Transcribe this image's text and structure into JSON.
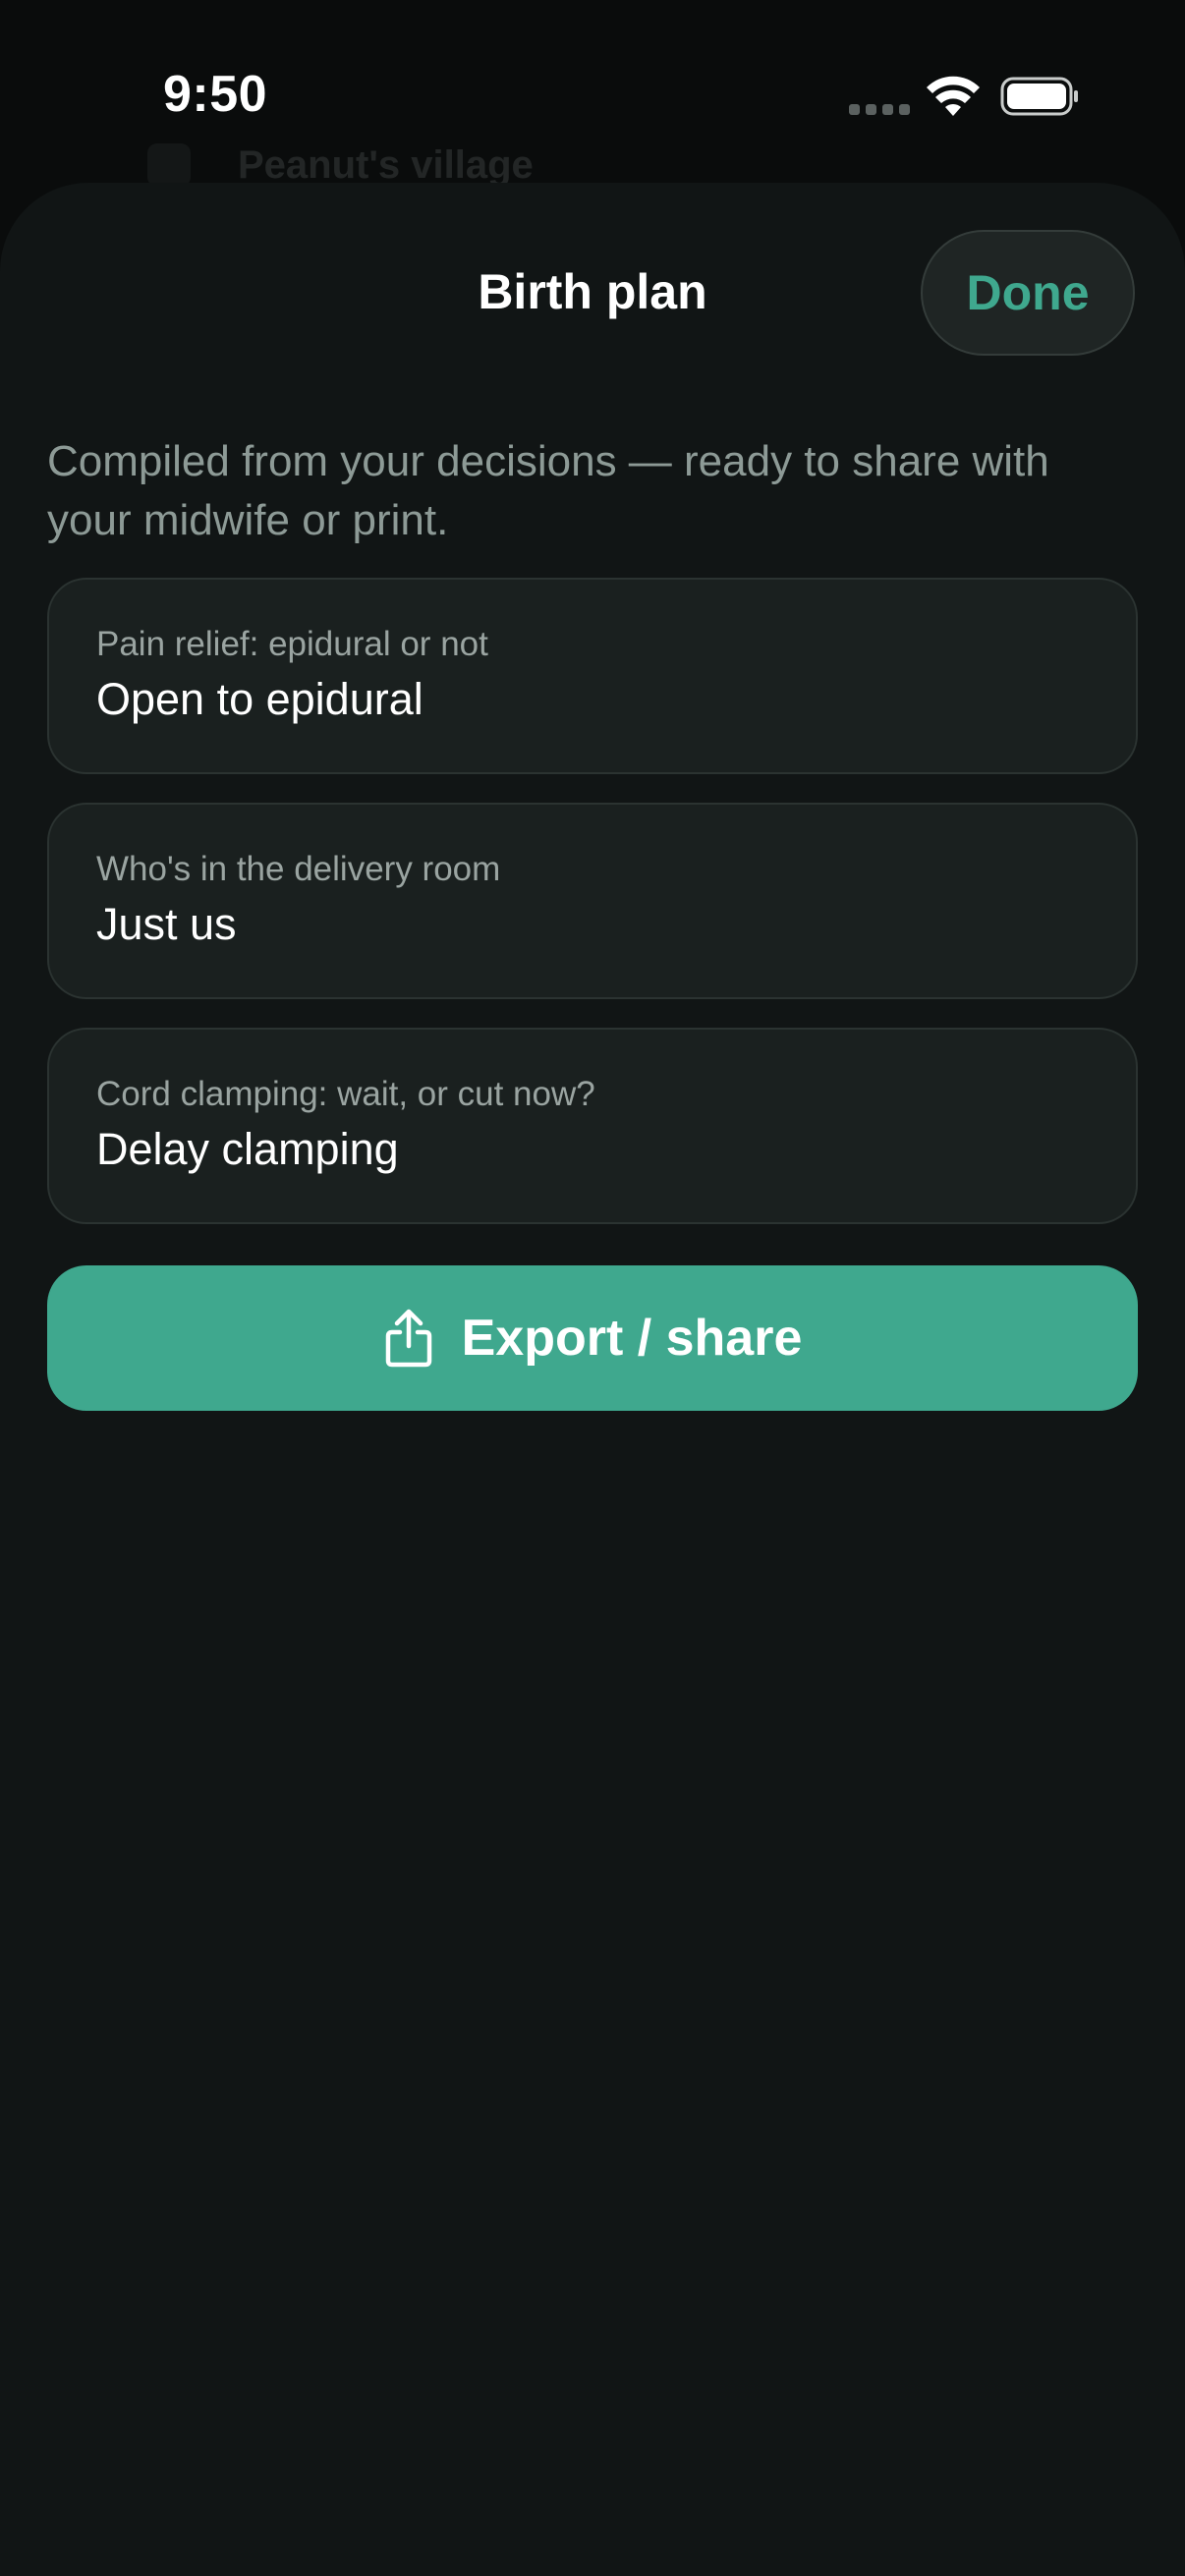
{
  "status_bar": {
    "time": "9:50"
  },
  "background": {
    "partial_title": "Peanut's village"
  },
  "sheet": {
    "title": "Birth plan",
    "done_label": "Done",
    "subtitle": "Compiled from your decisions — ready to share with your midwife or print."
  },
  "decisions": [
    {
      "question": "Pain relief: epidural or not",
      "answer": "Open to epidural"
    },
    {
      "question": "Who's in the delivery room",
      "answer": "Just us"
    },
    {
      "question": "Cord clamping: wait, or cut now?",
      "answer": "Delay clamping"
    }
  ],
  "export": {
    "label": "Export / share",
    "icon": "share-icon"
  },
  "colors": {
    "accent": "#3fa88e",
    "sheet_background": "#111515",
    "card_background": "#1a201f",
    "text_secondary": "#8d9a96"
  }
}
